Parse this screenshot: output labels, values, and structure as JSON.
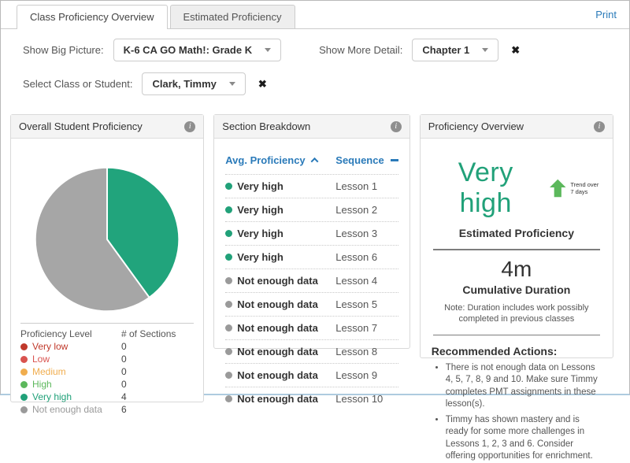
{
  "tabs": {
    "class_overview": "Class Proficiency Overview",
    "estimated": "Estimated Proficiency"
  },
  "print_label": "Print",
  "filters": {
    "big_picture_label": "Show Big Picture:",
    "big_picture_value": "K-6 CA GO Math!: Grade K",
    "more_detail_label": "Show More Detail:",
    "more_detail_value": "Chapter 1",
    "student_label": "Select Class or Student:",
    "student_value": "Clark, Timmy",
    "clear_icon": "✖"
  },
  "chart_data": {
    "type": "pie",
    "title": "Overall Student Proficiency",
    "categories": [
      "Very high",
      "Not enough data"
    ],
    "values": [
      4,
      6
    ],
    "colors": [
      "#21a47c",
      "#a6a6a6"
    ],
    "legend_position": "bottom"
  },
  "panels": {
    "overall": {
      "title": "Overall Student Proficiency",
      "legend_header_level": "Proficiency Level",
      "legend_header_count": "# of Sections",
      "legend": [
        {
          "label": "Very low",
          "count": "0",
          "color": "#c0392b"
        },
        {
          "label": "Low",
          "count": "0",
          "color": "#d9534f"
        },
        {
          "label": "Medium",
          "count": "0",
          "color": "#f0ad4e"
        },
        {
          "label": "High",
          "count": "0",
          "color": "#5cb85c"
        },
        {
          "label": "Very high",
          "count": "4",
          "color": "#21a179"
        },
        {
          "label": "Not enough data",
          "count": "6",
          "color": "#9a9a9a"
        }
      ]
    },
    "breakdown": {
      "title": "Section Breakdown",
      "col_proficiency": "Avg. Proficiency",
      "col_sequence": "Sequence",
      "rows": [
        {
          "proficiency": "Very high",
          "sequence": "Lesson 1",
          "color": "#21a179"
        },
        {
          "proficiency": "Very high",
          "sequence": "Lesson 2",
          "color": "#21a179"
        },
        {
          "proficiency": "Very high",
          "sequence": "Lesson 3",
          "color": "#21a179"
        },
        {
          "proficiency": "Very high",
          "sequence": "Lesson 6",
          "color": "#21a179"
        },
        {
          "proficiency": "Not enough data",
          "sequence": "Lesson 4",
          "color": "#9a9a9a"
        },
        {
          "proficiency": "Not enough data",
          "sequence": "Lesson 5",
          "color": "#9a9a9a"
        },
        {
          "proficiency": "Not enough data",
          "sequence": "Lesson 7",
          "color": "#9a9a9a"
        },
        {
          "proficiency": "Not enough data",
          "sequence": "Lesson 8",
          "color": "#9a9a9a"
        },
        {
          "proficiency": "Not enough data",
          "sequence": "Lesson 9",
          "color": "#9a9a9a"
        },
        {
          "proficiency": "Not enough data",
          "sequence": "Lesson 10",
          "color": "#9a9a9a"
        }
      ]
    },
    "overview": {
      "title": "Proficiency Overview",
      "level": "Very high",
      "level_color": "#21a179",
      "trend_label": "Trend over 7 days",
      "estimated_label": "Estimated Proficiency",
      "duration": "4m",
      "duration_label": "Cumulative Duration",
      "note": "Note: Duration includes work possibly completed in previous classes",
      "recommended_title": "Recommended Actions:",
      "recommendations": [
        "There is not enough data on Lessons 4, 5, 7, 8, 9 and 10. Make sure Timmy completes PMT assignments in these lesson(s).",
        "Timmy has shown mastery and is ready for some more challenges in Lessons 1, 2, 3 and 6. Consider offering opportunities for enrichment."
      ]
    }
  }
}
